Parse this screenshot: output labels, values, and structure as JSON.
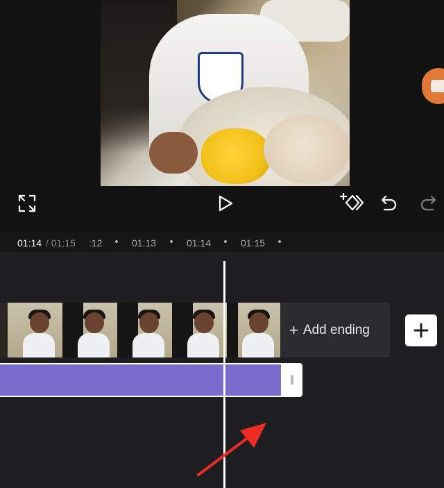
{
  "preview": {
    "fullscreen_icon": "fullscreen-icon",
    "play_icon": "play-icon",
    "keyframe_icon": "keyframe-add-icon",
    "undo_icon": "undo-icon",
    "redo_icon": "redo-icon"
  },
  "time": {
    "current": "01:14",
    "total": "/ 01:15",
    "ticks": [
      ":12",
      "01:13",
      "01:14",
      "01:15"
    ]
  },
  "timeline": {
    "add_ending_label": "Add ending",
    "add_ending_icon": "plus-icon",
    "add_clip_icon": "plus-icon"
  },
  "colors": {
    "background": "#121212",
    "timeline": "#1e1e20",
    "audio_track": "#7a6ccc",
    "record_accent": "#e07a36",
    "annotation_arrow": "#ee2b24"
  }
}
